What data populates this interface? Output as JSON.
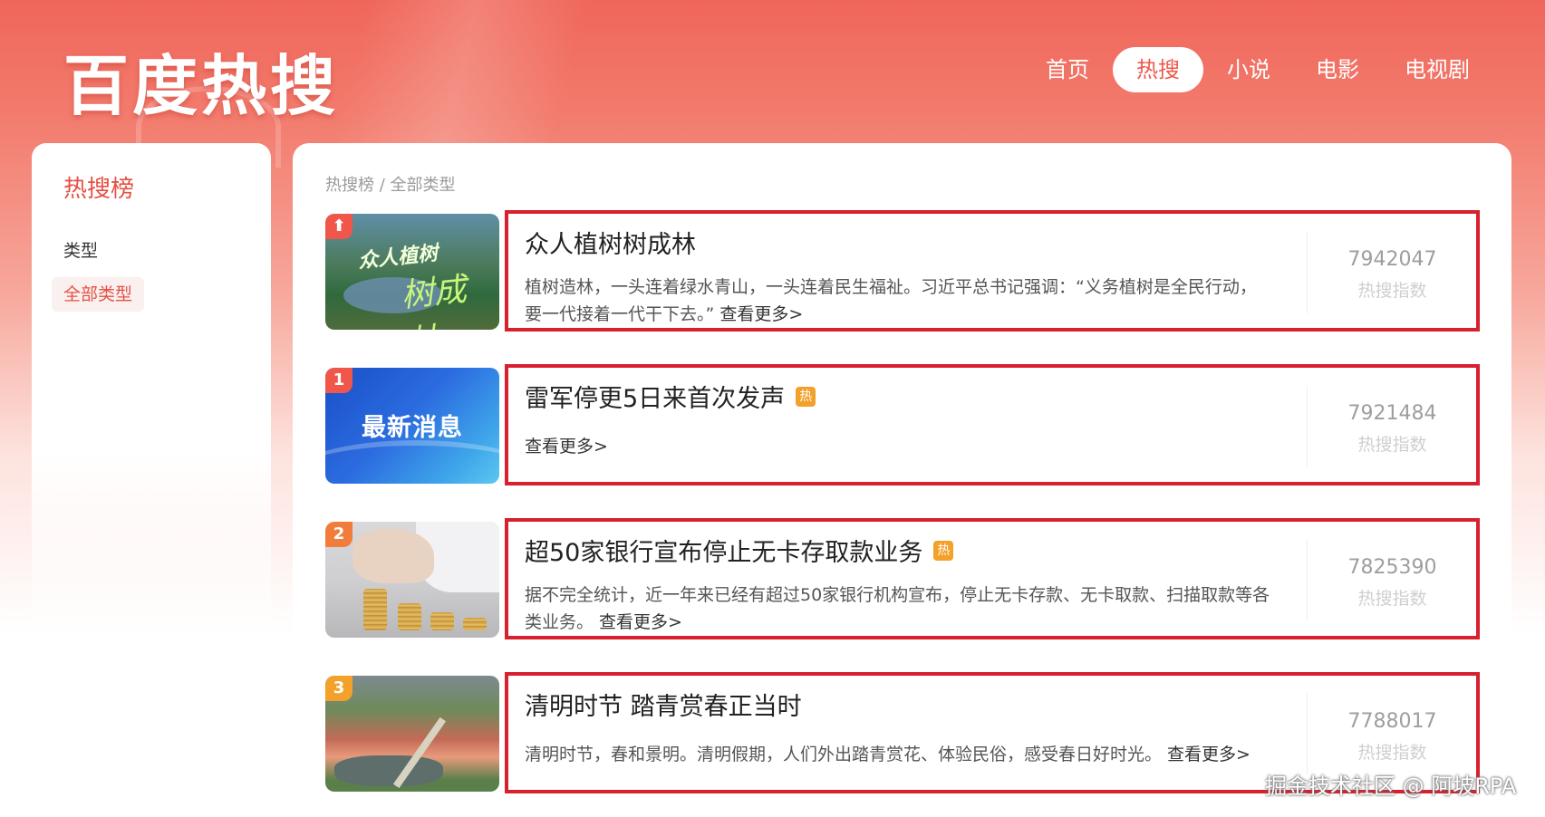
{
  "header": {
    "logo_text": "百度热搜",
    "nav": [
      {
        "label": "首页",
        "active": false
      },
      {
        "label": "热搜",
        "active": true
      },
      {
        "label": "小说",
        "active": false
      },
      {
        "label": "电影",
        "active": false
      },
      {
        "label": "电视剧",
        "active": false
      }
    ]
  },
  "sidebar": {
    "title": "热搜榜",
    "type_label": "类型",
    "selected_type": "全部类型"
  },
  "main": {
    "breadcrumb": "热搜榜 / 全部类型",
    "items": [
      {
        "rank": "⬆",
        "rank_color": "#f0574a",
        "thumb_caption": "众人植树",
        "thumb_caption_2": "树成林",
        "title": "众人植树树成林",
        "hot": false,
        "desc": "植树造林，一头连着绿水青山，一头连着民生福祉。习近平总书记强调：“义务植树是全民行动，要一代接着一代干下去。”",
        "more": "查看更多>",
        "score": "7942047",
        "score_label": "热搜指数"
      },
      {
        "rank": "1",
        "rank_color": "#f0574a",
        "thumb_caption": "最新消息",
        "title": "雷军停更5日来首次发声",
        "hot": true,
        "hot_label": "热",
        "desc": "",
        "more": "查看更多>",
        "score": "7921484",
        "score_label": "热搜指数"
      },
      {
        "rank": "2",
        "rank_color": "#f27c3b",
        "title": "超50家银行宣布停止无卡存取款业务",
        "hot": true,
        "hot_label": "热",
        "desc": "据不完全统计，近一年来已经有超过50家银行机构宣布，停止无卡存款、无卡取款、扫描取款等各类业务。",
        "more": "查看更多>",
        "score": "7825390",
        "score_label": "热搜指数"
      },
      {
        "rank": "3",
        "rank_color": "#f3a12a",
        "title": "清明时节 踏青赏春正当时",
        "hot": false,
        "desc": "清明时节，春和景明。清明假期，人们外出踏青赏花、体验民俗，感受春日好时光。",
        "more": "查看更多>",
        "score": "7788017",
        "score_label": "热搜指数"
      }
    ]
  },
  "watermark": "掘金技术社区 @ 阿坡RPA",
  "colors": {
    "brand": "#f0574a",
    "highlight_border": "#d8202e",
    "hot_badge": "#f3a12a"
  }
}
